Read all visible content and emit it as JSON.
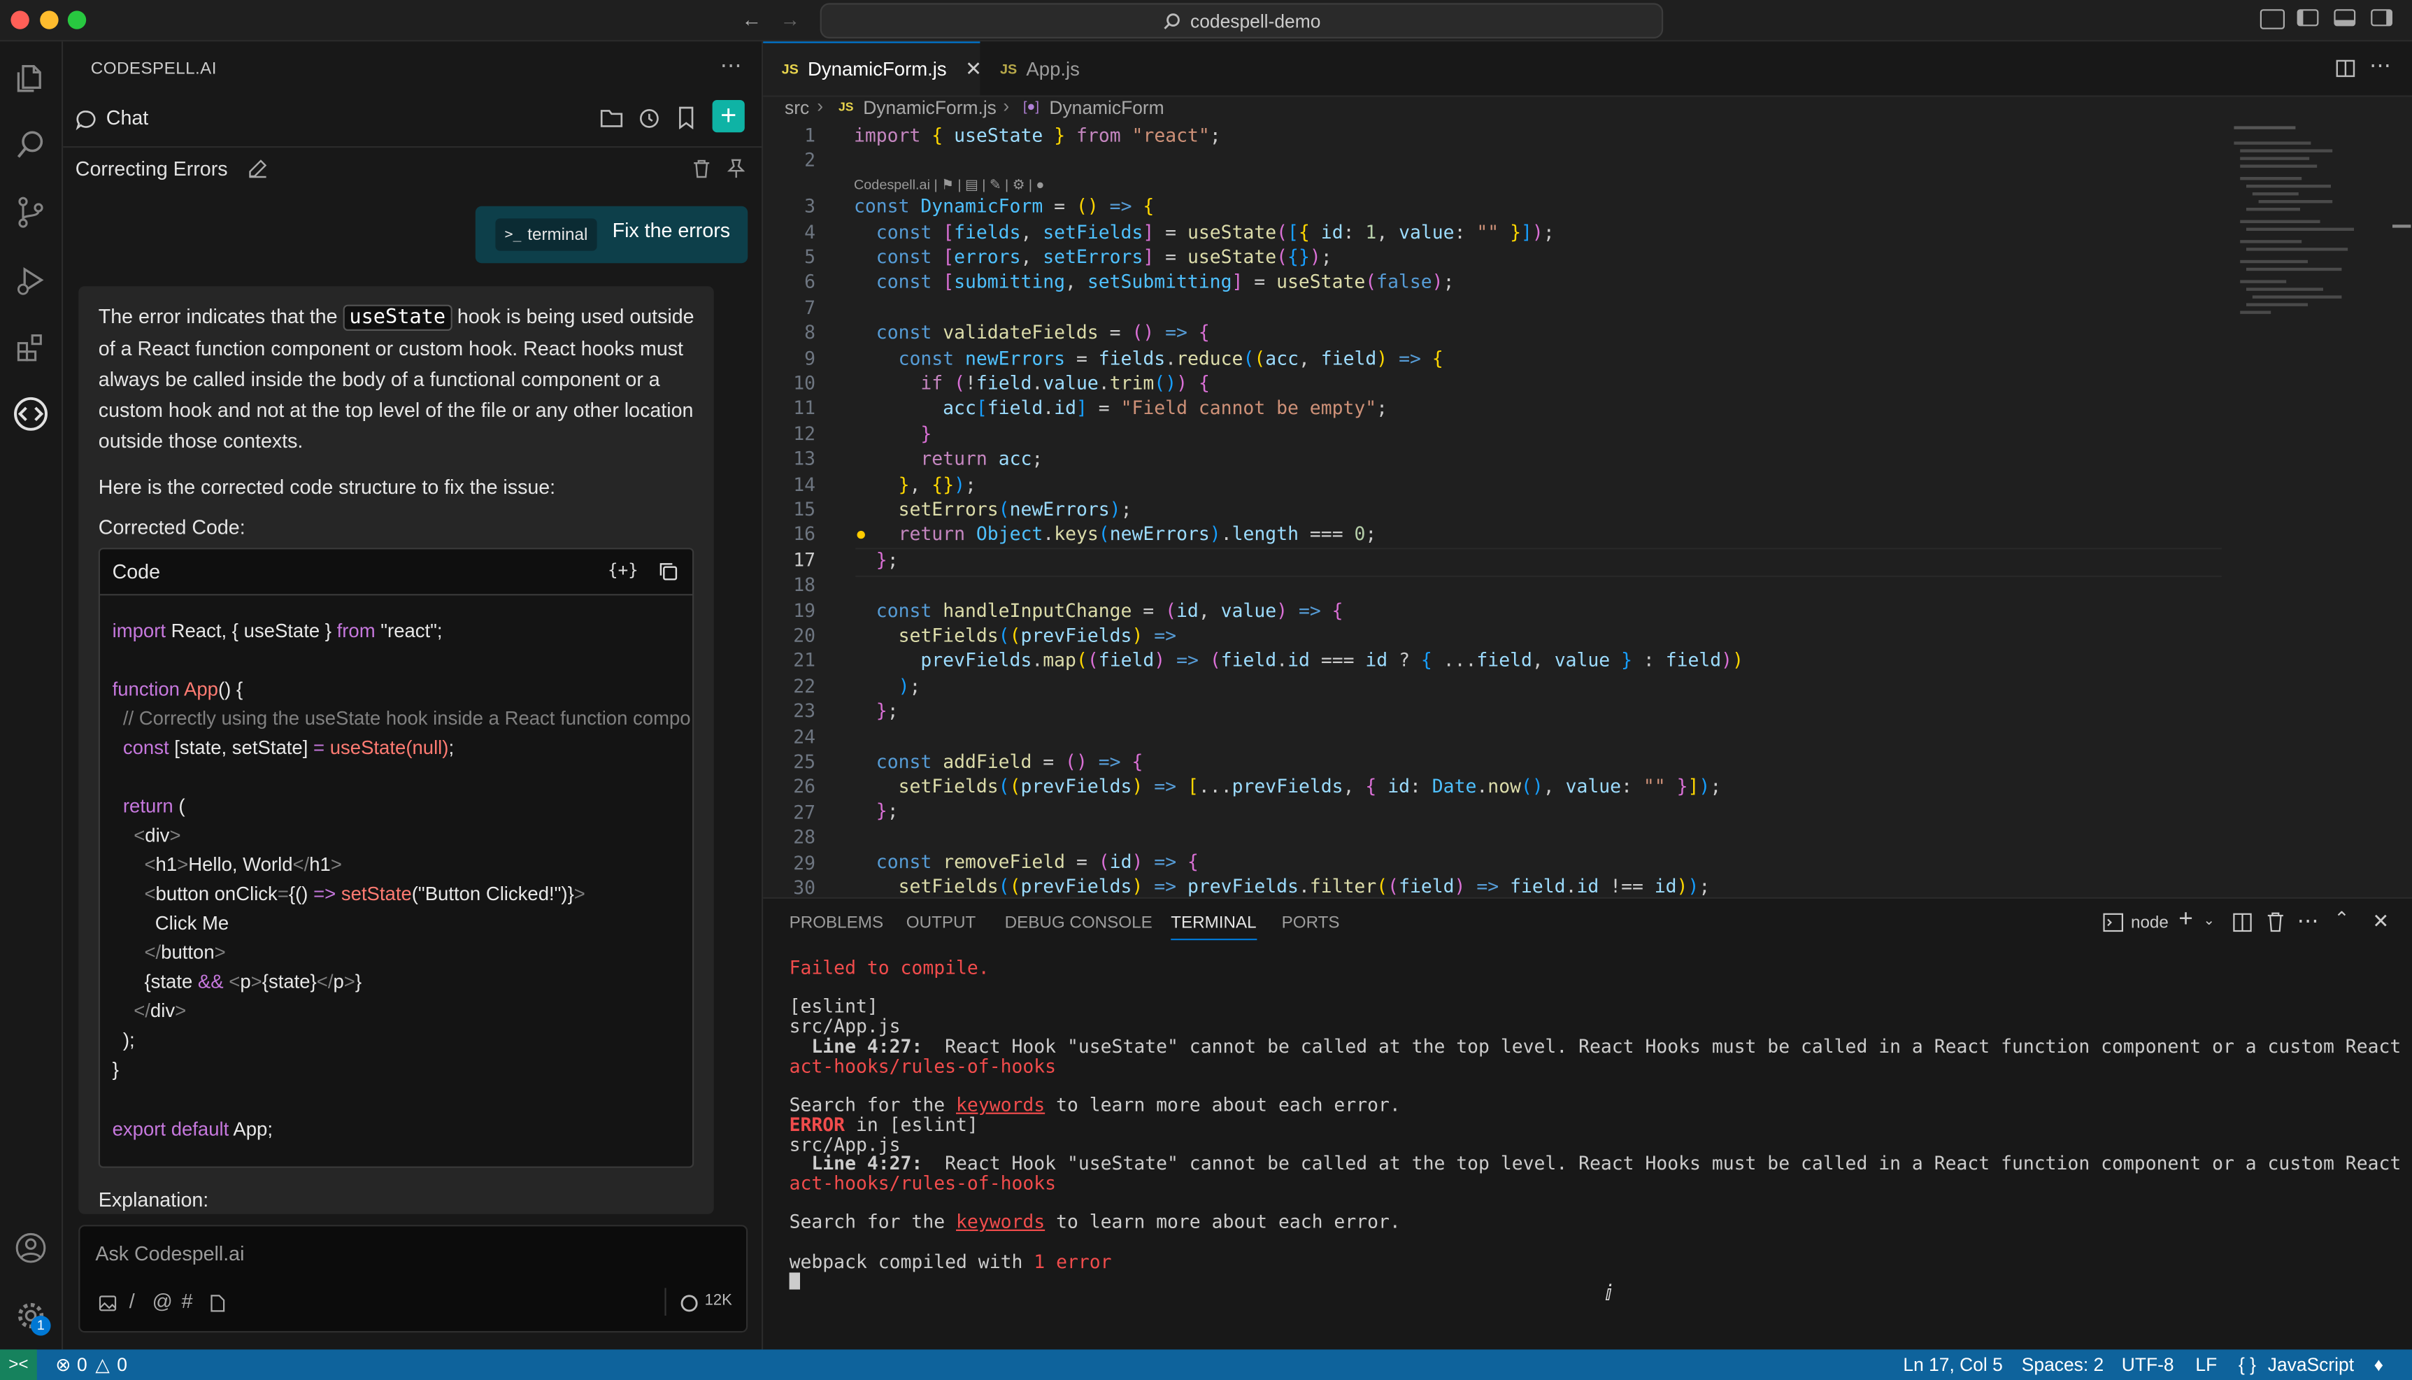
{
  "window": {
    "title": "codespell-demo"
  },
  "colors": {
    "accent": "#0078d4",
    "status_bar": "#0e639c",
    "new_chat_button": "#0fb3a5",
    "error": "#f14c4c"
  },
  "chat": {
    "brand": "CODESPELL.AI",
    "header_title": "Chat",
    "session_title": "Correcting Errors",
    "user_badge": "terminal",
    "user_message": "Fix the errors",
    "response_p1_a": "The error indicates that the",
    "response_p1_code": "useState",
    "response_p1_b": "hook is being used outside",
    "response_p1_lines": [
      "of a React function component or custom hook. React hooks must",
      "always be called inside the body of a functional component or a",
      "custom hook and not at the top level of the file or any other location",
      "outside those contexts."
    ],
    "response_p2": "Here is the corrected code structure to fix the issue:",
    "corrected_label": "Corrected Code:",
    "code_block_title": "Code",
    "code": {
      "l1_import": "import",
      "l1_rest": " React, { useState } ",
      "l1_from": "from",
      "l1_str": " \"react\";",
      "l2_kw": "function",
      "l2_fn": " App",
      "l2_rest": "() {",
      "l3": "  // Correctly using the useState hook inside a React function compo",
      "l4_kw": "  const",
      "l4_rest": " [state, setState] ",
      "l4_eq": "=",
      "l4_fn": " useState",
      "l4_args": "(null)",
      "l4_end": ";",
      "l5_kw": "  return",
      "l5_rest": " (",
      "l6": "div",
      "l7_tag": "h1",
      "l7_text": "Hello, World",
      "l8_a": "button onClick",
      "l8_b": "{() ",
      "l8_c": "=>",
      "l8_fn": " setState",
      "l8_d": "(\"Button Clicked!\")}",
      "l9": "Click Me",
      "l10": "button",
      "l11_a": "{state ",
      "l11_op": "&&",
      "l11_p": "p",
      "l11_b": "{state}",
      "l12": "div",
      "l13": "  );",
      "l14": "}",
      "l15_kw": "export",
      "l15_kw2": " default",
      "l15_rest": " App;"
    },
    "explanation_label": "Explanation:",
    "input_placeholder": "Ask Codespell.ai",
    "token_count": "12K"
  },
  "editor": {
    "tabs": [
      {
        "icon": "JS",
        "label": "DynamicForm.js",
        "active": true
      },
      {
        "icon": "JS",
        "label": "App.js",
        "active": false
      }
    ],
    "breadcrumb": [
      "src",
      "DynamicForm.js",
      "DynamicForm"
    ],
    "codelens": "Codespell.ai |",
    "line_numbers": [
      "1",
      "2",
      "3",
      "4",
      "5",
      "6",
      "7",
      "8",
      "9",
      "10",
      "11",
      "12",
      "13",
      "14",
      "15",
      "16",
      "17",
      "18",
      "19",
      "20",
      "21",
      "22",
      "23",
      "24",
      "25",
      "26",
      "27",
      "28",
      "29",
      "30"
    ]
  },
  "panel": {
    "tabs": [
      "PROBLEMS",
      "OUTPUT",
      "DEBUG CONSOLE",
      "TERMINAL",
      "PORTS"
    ],
    "active_tab": "TERMINAL",
    "shell": "node",
    "lines": {
      "t1": "Failed to compile.",
      "t2": "[eslint]",
      "t3": "src/App.js",
      "t4a": "  Line 4:27:",
      "t4b": "  React Hook \"useState\" cannot be called at the top level. React Hooks must be called in a React function component or a custom React Hook function  ",
      "t4c": "re",
      "t5": "act-hooks/rules-of-hooks",
      "t6a": "Search for the ",
      "t6b": "keywords",
      "t6c": " to learn more about each error.",
      "t7a": "ERROR",
      "t7b": " in [eslint]",
      "t8": "src/App.js",
      "t11a": "webpack compiled with ",
      "t11b": "1 error"
    }
  },
  "status": {
    "errors": "0",
    "warnings": "0",
    "position": "Ln 17, Col 5",
    "spaces": "Spaces: 2",
    "encoding": "UTF-8",
    "eol": "LF",
    "language": "JavaScript",
    "account_badge": "1"
  }
}
